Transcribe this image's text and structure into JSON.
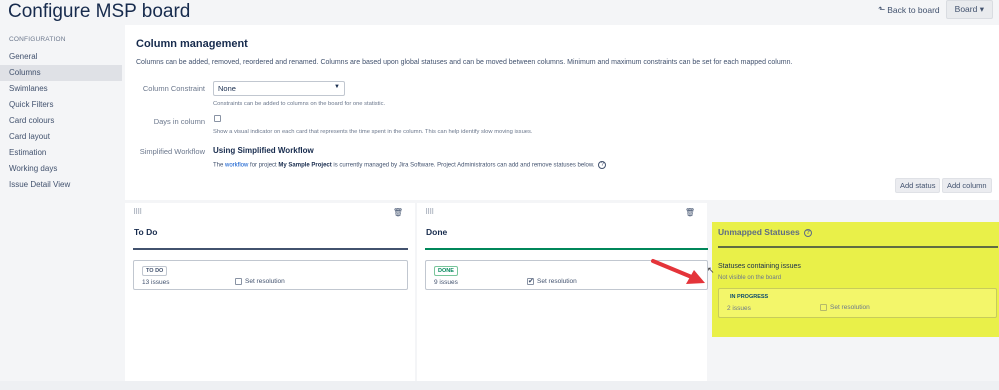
{
  "header": {
    "title": "Configure MSP board",
    "back_label": "Back to board",
    "board_label": "Board"
  },
  "sidebar": {
    "heading": "CONFIGURATION",
    "items": [
      {
        "label": "General"
      },
      {
        "label": "Columns"
      },
      {
        "label": "Swimlanes"
      },
      {
        "label": "Quick Filters"
      },
      {
        "label": "Card colours"
      },
      {
        "label": "Card layout"
      },
      {
        "label": "Estimation"
      },
      {
        "label": "Working days"
      },
      {
        "label": "Issue Detail View"
      }
    ]
  },
  "main": {
    "title": "Column management",
    "description": "Columns can be added, removed, reordered and renamed. Columns are based upon global statuses and can be moved between columns. Minimum and maximum constraints can be set for each mapped column.",
    "constraint_label": "Column Constraint",
    "constraint_value": "None",
    "constraint_help": "Constraints can be added to columns on the board for one statistic.",
    "days_label": "Days in column",
    "days_help": "Show a visual indicator on each card that represents the time spent in the column. This can help identify slow moving issues.",
    "workflow_label": "Simplified Workflow",
    "workflow_title": "Using Simplified Workflow",
    "workflow_text_1": "The",
    "workflow_link": "workflow",
    "workflow_text_2": "for project",
    "workflow_project": "My Sample Project",
    "workflow_text_3": "is currently managed by Jira Software. Project Administrators can add and remove statuses below.",
    "add_status": "Add status",
    "add_column": "Add column"
  },
  "columns": [
    {
      "title": "To Do",
      "status": "TO DO",
      "issues": "13 issues",
      "resolution": "Set resolution",
      "checked": false,
      "bar_color": "#42526e"
    },
    {
      "title": "Done",
      "status": "DONE",
      "issues": "9 issues",
      "resolution": "Set resolution",
      "checked": true,
      "bar_color": "#00875a"
    }
  ],
  "unmapped": {
    "title": "Unmapped Statuses",
    "subtitle": "Statuses containing issues",
    "subtitle2": "Not visible on the board",
    "status": "IN PROGRESS",
    "issues": "2 issues",
    "resolution": "Set resolution"
  },
  "colors": {
    "highlight": "#e9f049",
    "arrow": "#e4343a",
    "done_green": "#00875a"
  }
}
